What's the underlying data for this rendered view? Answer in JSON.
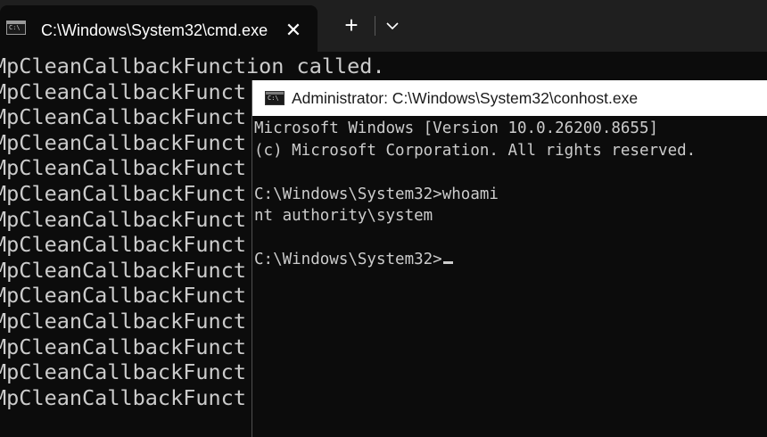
{
  "terminal": {
    "tab": {
      "title": "C:\\Windows\\System32\\cmd.exe",
      "icon": "console-icon",
      "close_glyph": "✕"
    },
    "new_tab_glyph": "+",
    "dropdown_icon": "chevron-down-icon",
    "output_lines": [
      "MpCleanCallbackFunction called.",
      "MpCleanCallbackFunct",
      "MpCleanCallbackFunct",
      "MpCleanCallbackFunct",
      "MpCleanCallbackFunct",
      "MpCleanCallbackFunct",
      "MpCleanCallbackFunct",
      "MpCleanCallbackFunct",
      "MpCleanCallbackFunct",
      "MpCleanCallbackFunct",
      "MpCleanCallbackFunct",
      "MpCleanCallbackFunct",
      "MpCleanCallbackFunct",
      "MpCleanCallbackFunct"
    ]
  },
  "conhost": {
    "title": "Administrator: C:\\Windows\\System32\\conhost.exe",
    "icon": "console-icon",
    "lines": [
      "Microsoft Windows [Version 10.0.26200.8655]",
      "(c) Microsoft Corporation. All rights reserved.",
      "",
      "C:\\Windows\\System32>whoami",
      "nt authority\\system",
      "",
      "C:\\Windows\\System32>"
    ]
  },
  "colors": {
    "terminal_bg": "#0c0c0c",
    "tabbar_bg": "#1f1f1f",
    "text": "#cccccc",
    "titlebar_bg": "#ffffff"
  }
}
